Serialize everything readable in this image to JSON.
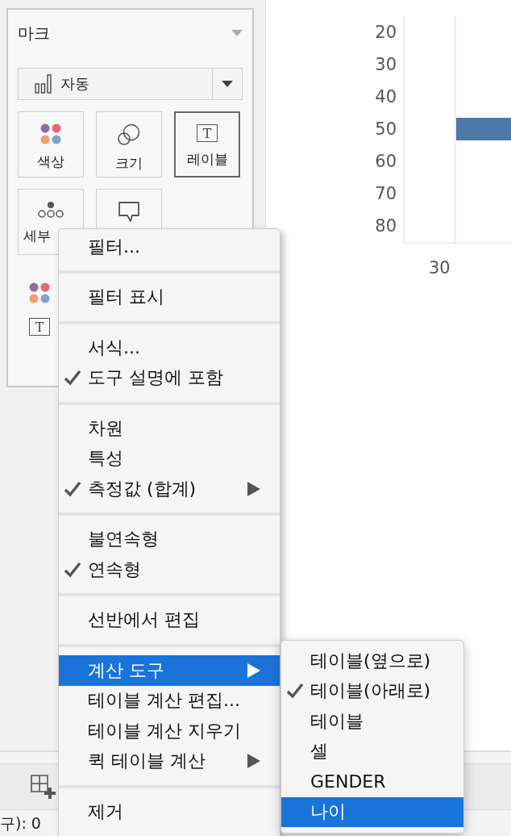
{
  "marks_card": {
    "title": "마크",
    "mark_type": {
      "value": "자동"
    },
    "buttons": [
      {
        "kind": "color",
        "label": "색상",
        "selected": false
      },
      {
        "kind": "size",
        "label": "크기",
        "selected": false
      },
      {
        "kind": "label",
        "label": "레이블",
        "icon_glyph": "T",
        "selected": true
      },
      {
        "kind": "detail",
        "label": "세부",
        "selected": false
      },
      {
        "kind": "tooltip",
        "selected": false
      }
    ],
    "shelf": [
      {
        "kind": "color"
      },
      {
        "kind": "label",
        "icon_glyph": "T"
      }
    ]
  },
  "chart": {
    "rows": [
      {
        "label": "20",
        "bar": false
      },
      {
        "label": "30",
        "bar": false
      },
      {
        "label": "40",
        "bar": false
      },
      {
        "label": "50",
        "bar": true
      },
      {
        "label": "60",
        "bar": false
      },
      {
        "label": "70",
        "bar": false
      },
      {
        "label": "80",
        "bar": false
      }
    ],
    "x_labels": [
      "30"
    ]
  },
  "context_menu": {
    "sections": [
      [
        {
          "label": "필터...",
          "checked": false,
          "has_submenu": false,
          "selected": false
        }
      ],
      [
        {
          "label": "필터 표시",
          "checked": false,
          "has_submenu": false,
          "selected": false
        }
      ],
      [
        {
          "label": "서식...",
          "checked": false,
          "has_submenu": false,
          "selected": false
        },
        {
          "label": "도구 설명에 포함",
          "checked": true,
          "has_submenu": false,
          "selected": false
        }
      ],
      [
        {
          "label": "차원",
          "checked": false,
          "has_submenu": false,
          "selected": false
        },
        {
          "label": "특성",
          "checked": false,
          "has_submenu": false,
          "selected": false
        },
        {
          "label": "측정값 (합계)",
          "checked": true,
          "has_submenu": true,
          "selected": false
        }
      ],
      [
        {
          "label": "불연속형",
          "checked": false,
          "has_submenu": false,
          "selected": false
        },
        {
          "label": "연속형",
          "checked": true,
          "has_submenu": false,
          "selected": false
        }
      ],
      [
        {
          "label": "선반에서 편집",
          "checked": false,
          "has_submenu": false,
          "selected": false
        }
      ],
      [
        {
          "label": "계산 도구",
          "checked": false,
          "has_submenu": true,
          "selected": true
        },
        {
          "label": "테이블 계산 편집...",
          "checked": false,
          "has_submenu": false,
          "selected": false
        },
        {
          "label": "테이블 계산 지우기",
          "checked": false,
          "has_submenu": false,
          "selected": false
        },
        {
          "label": "퀵 테이블 계산",
          "checked": false,
          "has_submenu": true,
          "selected": false
        }
      ],
      [
        {
          "label": "제거",
          "checked": false,
          "has_submenu": false,
          "selected": false
        }
      ]
    ]
  },
  "submenu": {
    "items": [
      {
        "label": "테이블(옆으로)",
        "checked": false,
        "selected": false
      },
      {
        "label": "테이블(아래로)",
        "checked": true,
        "selected": false
      },
      {
        "label": "테이블",
        "checked": false,
        "selected": false
      },
      {
        "label": "셀",
        "checked": false,
        "selected": false
      },
      {
        "label": "GENDER",
        "checked": false,
        "selected": false
      },
      {
        "label": "나이",
        "checked": false,
        "selected": true
      }
    ]
  },
  "status_bar": {
    "text": "구): 0"
  }
}
